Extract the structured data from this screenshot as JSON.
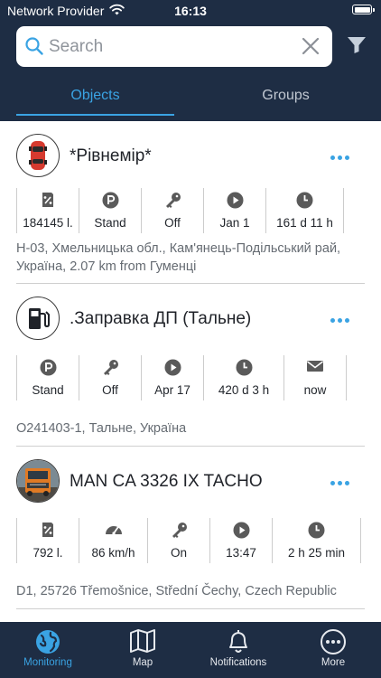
{
  "status_bar": {
    "carrier": "Network Provider",
    "time": "16:13"
  },
  "search": {
    "placeholder": "Search"
  },
  "tabs": [
    {
      "label": "Objects"
    },
    {
      "label": "Groups"
    }
  ],
  "objects": [
    {
      "name": "*Рівнемір*",
      "avatar": "red-car-icon",
      "stats": [
        {
          "icon": "fuel-gauge-icon",
          "value": "184145 l."
        },
        {
          "icon": "parking-icon",
          "value": "Stand"
        },
        {
          "icon": "key-icon",
          "value": "Off"
        },
        {
          "icon": "play-icon",
          "value": "Jan 1"
        },
        {
          "icon": "clock-icon",
          "value": "161 d 11 h"
        }
      ],
      "address": "Н-03, Хмельницька обл., Кам'янець-Подільський рай, Україна, 2.07 km from Гуменці"
    },
    {
      "name": ".Заправка ДП (Тальне)",
      "avatar": "fuel-station-icon",
      "stats": [
        {
          "icon": "parking-icon",
          "value": "Stand"
        },
        {
          "icon": "key-icon",
          "value": "Off"
        },
        {
          "icon": "play-icon",
          "value": "Apr 17"
        },
        {
          "icon": "clock-icon",
          "value": "420 d 3 h"
        },
        {
          "icon": "envelope-icon",
          "value": "now"
        }
      ],
      "address": "O241403-1, Тальне, Україна"
    },
    {
      "name": "MAN CA 3326 IX TACHO",
      "avatar": "truck-photo-icon",
      "stats": [
        {
          "icon": "fuel-gauge-icon",
          "value": "792 l."
        },
        {
          "icon": "speedometer-icon",
          "value": "86 km/h"
        },
        {
          "icon": "key-icon",
          "value": "On"
        },
        {
          "icon": "play-icon",
          "value": "13:47"
        },
        {
          "icon": "clock-icon",
          "value": "2 h 25 min"
        }
      ],
      "address": "D1, 25726 Třemošnice, Střední Čechy, Czech Republic"
    }
  ],
  "bottom_nav": [
    {
      "label": "Monitoring",
      "icon": "globe-icon",
      "active": true
    },
    {
      "label": "Map",
      "icon": "map-icon",
      "active": false
    },
    {
      "label": "Notifications",
      "icon": "bell-icon",
      "active": false
    },
    {
      "label": "More",
      "icon": "more-circle-icon",
      "active": false
    }
  ],
  "colors": {
    "header": "#1e2d44",
    "accent": "#3aa3e3",
    "icon_gray": "#5a5a5a",
    "inactive_tab": "#c1c8d2"
  }
}
